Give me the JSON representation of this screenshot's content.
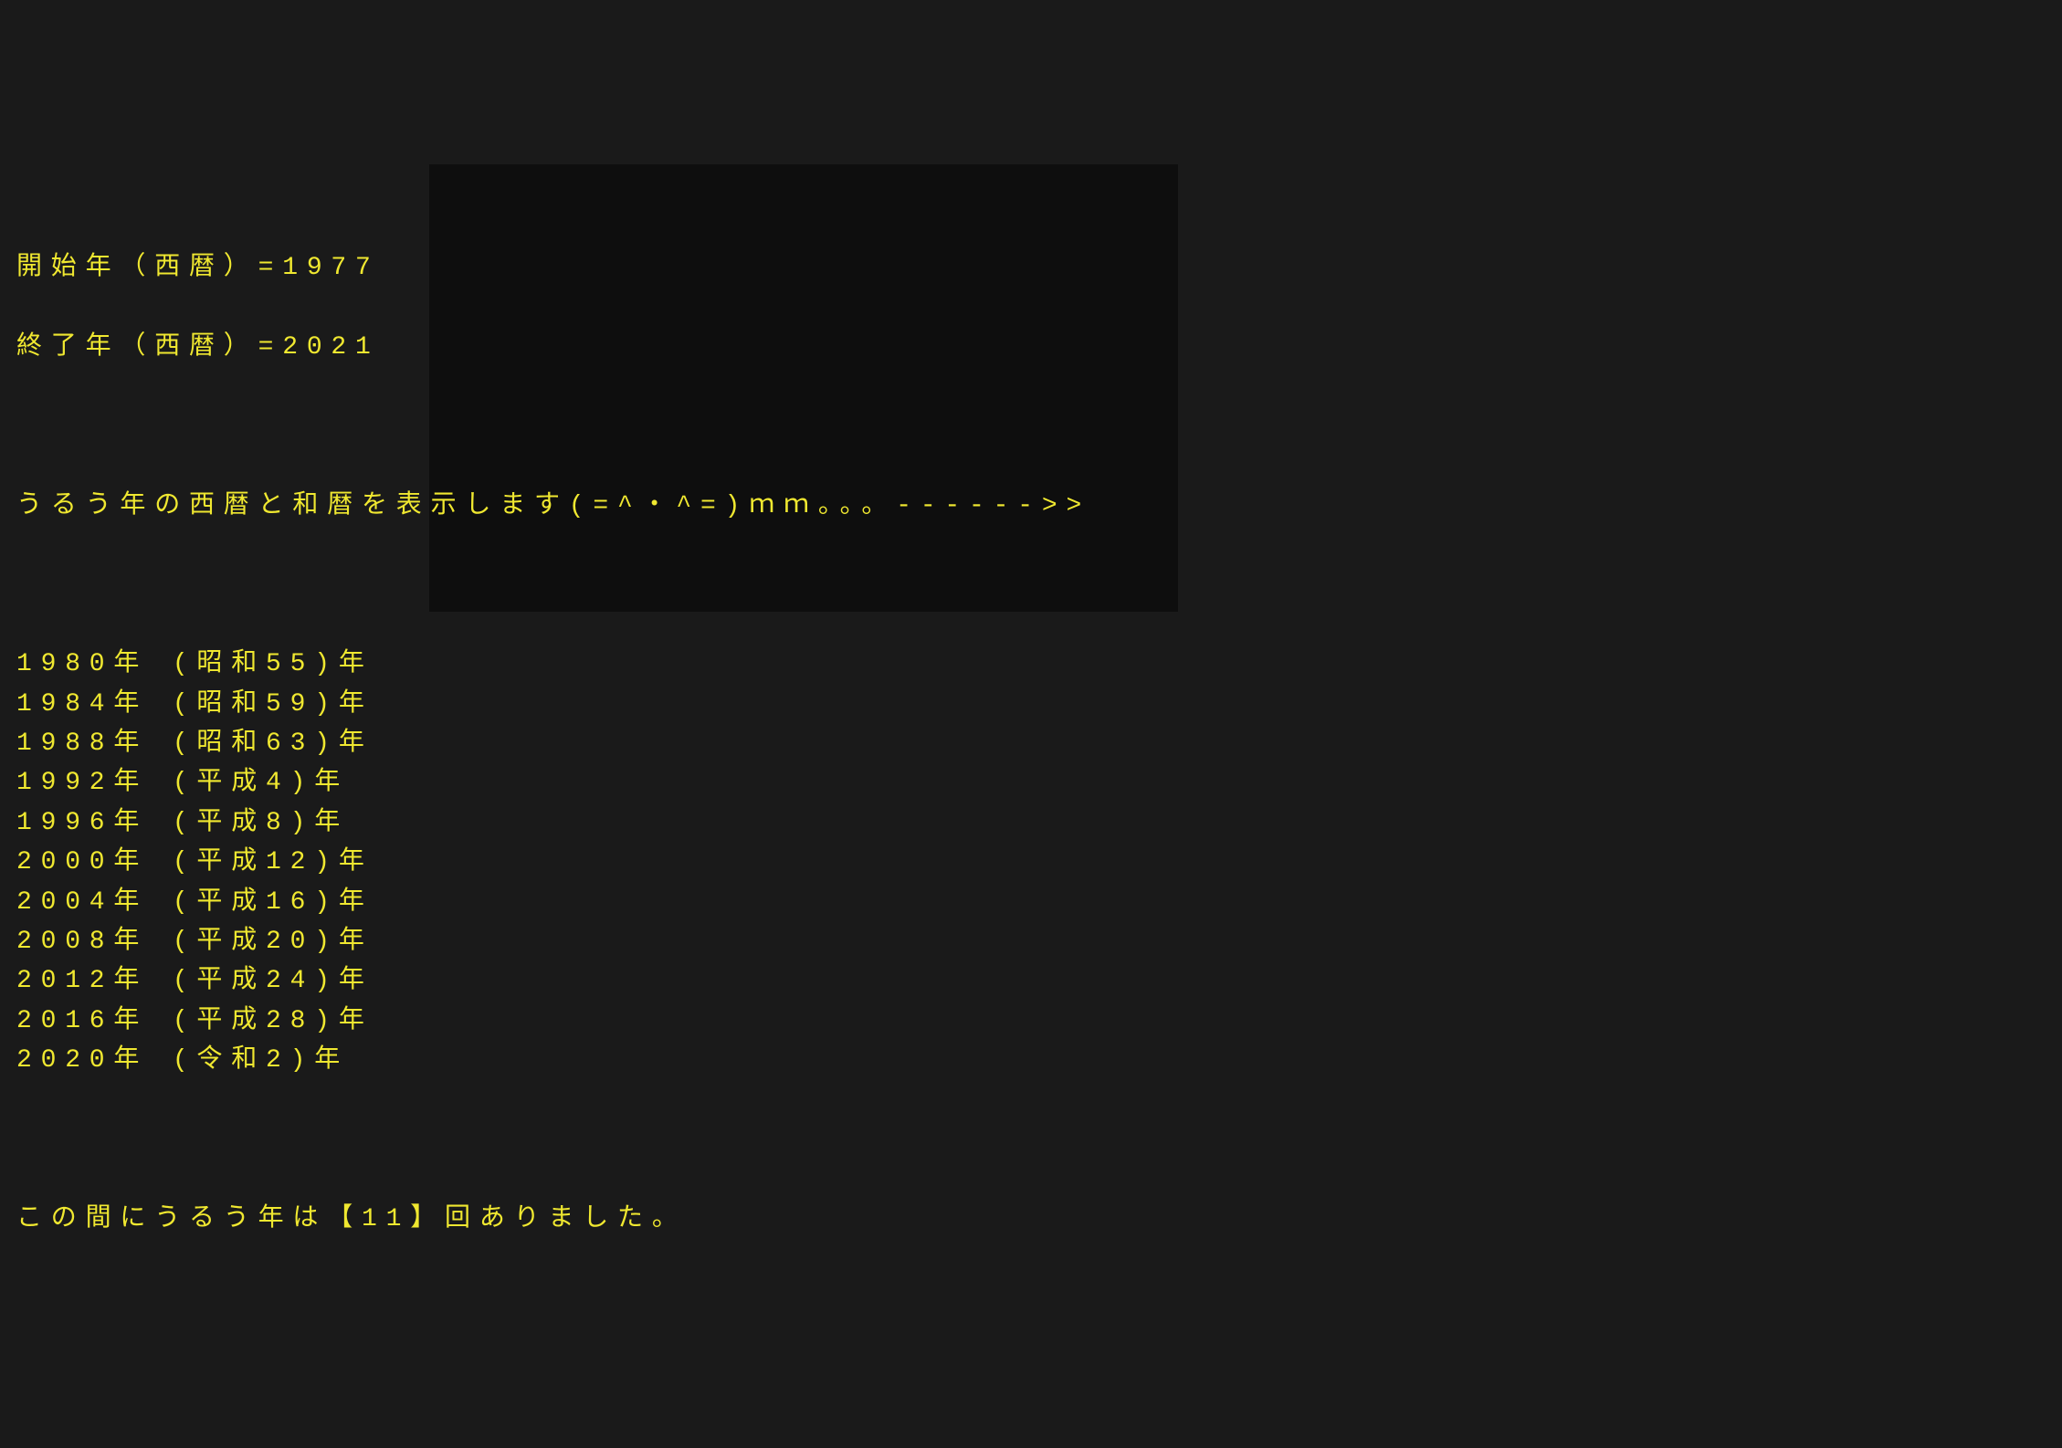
{
  "header": {
    "start_label": "開始年（西暦）=",
    "start_value": "1977",
    "end_label": "終了年（西暦）=",
    "end_value": "2021"
  },
  "message": "うるう年の西暦と和暦を表示します(=^・^=)ｍｍ。。。------>>",
  "rows": [
    {
      "western": "1980年",
      "japanese": "(昭和55)年"
    },
    {
      "western": "1984年",
      "japanese": "(昭和59)年"
    },
    {
      "western": "1988年",
      "japanese": "(昭和63)年"
    },
    {
      "western": "1992年",
      "japanese": "(平成4)年"
    },
    {
      "western": "1996年",
      "japanese": "(平成8)年"
    },
    {
      "western": "2000年",
      "japanese": "(平成12)年"
    },
    {
      "western": "2004年",
      "japanese": "(平成16)年"
    },
    {
      "western": "2008年",
      "japanese": "(平成20)年"
    },
    {
      "western": "2012年",
      "japanese": "(平成24)年"
    },
    {
      "western": "2016年",
      "japanese": "(平成28)年"
    },
    {
      "western": "2020年",
      "japanese": "(令和2)年"
    }
  ],
  "footer": {
    "prefix": "この間にうるう年は【",
    "count": "11",
    "suffix": "】回ありました。"
  }
}
